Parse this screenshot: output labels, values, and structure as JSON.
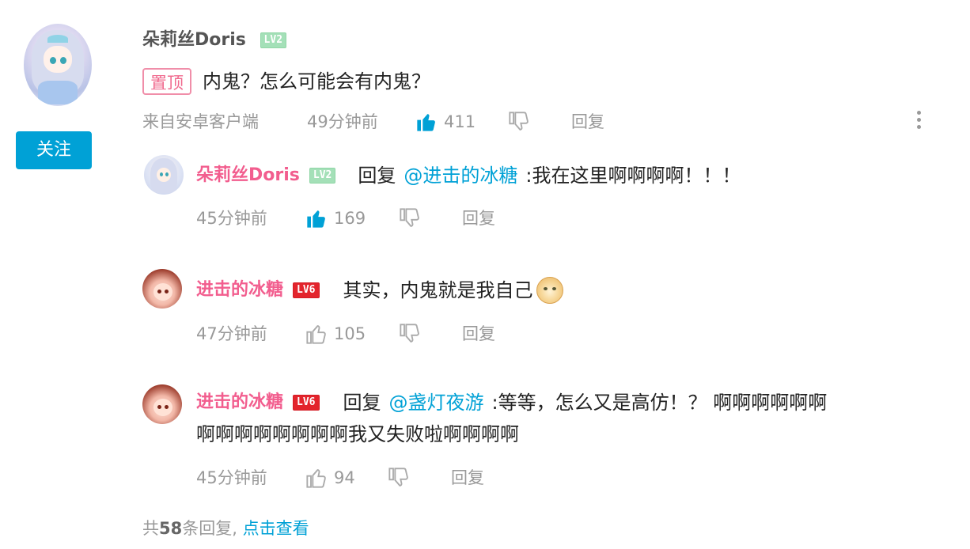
{
  "main_comment": {
    "username": "朵莉丝Doris",
    "level": "LV2",
    "pin_label": "置顶",
    "text": "内鬼？怎么可能会有内鬼？",
    "source": "来自安卓客户端",
    "time": "49分钟前",
    "likes": "411",
    "reply_label": "回复",
    "follow_label": "关注"
  },
  "replies": [
    {
      "username": "朵莉丝Doris",
      "level": "LV2",
      "reply_prefix": "回复",
      "mention": "@进击的冰糖",
      "text": ":我在这里啊啊啊啊！！！",
      "time": "45分钟前",
      "likes": "169",
      "reply_label": "回复",
      "liked": true
    },
    {
      "username": "进击的冰糖",
      "level": "LV6",
      "text": "其实，内鬼就是我自己",
      "time": "47分钟前",
      "likes": "105",
      "reply_label": "回复",
      "liked": false,
      "emoji": "doge"
    },
    {
      "username": "进击的冰糖",
      "level": "LV6",
      "reply_prefix": "回复",
      "mention": "@盏灯夜游",
      "text": ":等等，怎么又是高仿！？ 啊啊啊啊啊啊",
      "text_line2": "啊啊啊啊啊啊啊啊我又失败啦啊啊啊啊",
      "time": "45分钟前",
      "likes": "94",
      "reply_label": "回复",
      "liked": false
    }
  ],
  "footer": {
    "prefix": "共",
    "count": "58",
    "suffix": "条回复,",
    "link": "点击查看"
  },
  "colors": {
    "accent": "#00a1d6",
    "username_pink": "#f25d8e",
    "meta_gray": "#999999",
    "lv2_green": "#a4e0b8",
    "lv6_red": "#e3242c"
  }
}
